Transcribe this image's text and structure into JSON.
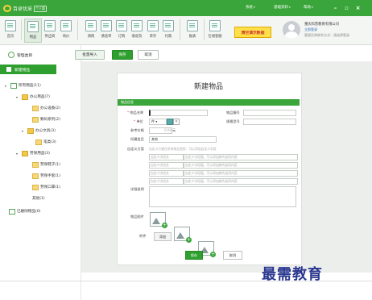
{
  "app": {
    "logo_text": "百卓优采",
    "edition": "个人版",
    "top_menu": [
      "系统",
      "基础资料",
      "帮助"
    ],
    "colors": {
      "primary": "#3aa53a",
      "primary_dark": "#2fa02f",
      "demo_button": "#ffe048",
      "watermark": "#2b3890"
    }
  },
  "toolbar": {
    "items": [
      {
        "label": "首页",
        "icon": "home-icon"
      },
      {
        "label": "物品",
        "icon": "goods-icon",
        "active": true
      },
      {
        "label": "供应商",
        "icon": "supplier-icon"
      },
      {
        "label": "询价",
        "icon": "inquiry-icon"
      },
      {
        "label": "请购",
        "icon": "request-icon"
      },
      {
        "label": "请验单",
        "icon": "inspection-icon"
      },
      {
        "label": "订购",
        "icon": "order-icon"
      },
      {
        "label": "收退货",
        "icon": "receive-icon"
      },
      {
        "label": "库存",
        "icon": "stock-icon"
      },
      {
        "label": "付款",
        "icon": "payment-icon"
      },
      {
        "label": "报表",
        "icon": "report-icon"
      },
      {
        "label": "在线客服",
        "icon": "service-icon"
      }
    ],
    "demo_button": "清空演示数据",
    "company": "重庆科普教育有限公司",
    "login": "立即登录",
    "contact": "管理员常联系方式：请选择登录"
  },
  "sidebar": {
    "manage_label": "管理类目",
    "new_goods": "新建物品",
    "tree": [
      {
        "label": "所有物品(11)",
        "level": 0
      },
      {
        "label": "办公用品(7)",
        "level": 1
      },
      {
        "label": "办公设备(2)",
        "level": 2
      },
      {
        "label": "数码系列(2)",
        "level": 2
      },
      {
        "label": "办公文具(3)",
        "level": 2
      },
      {
        "label": "笔类(3)",
        "level": 3
      },
      {
        "label": "劳保用品(3)",
        "level": 1
      },
      {
        "label": "劳保鞋子(1)",
        "level": 2
      },
      {
        "label": "劳保手套(1)",
        "level": 2
      },
      {
        "label": "劳保口罩(1)",
        "level": 2
      },
      {
        "label": "其他(1)",
        "level": 2
      },
      {
        "label": "已删除物品(0)",
        "level": 0
      }
    ]
  },
  "actions": {
    "import": "批量导入",
    "save": "保存",
    "cancel": "取消"
  },
  "form": {
    "title": "新建物品",
    "section": "物品信息",
    "fields": {
      "name_label": "物品名称",
      "code_label": "物品编号",
      "unit_label": "单位",
      "unit_value": "件",
      "spec_label": "规格型号",
      "ref_price_label": "参考价格",
      "ref_price_value": "0.00",
      "ref_price_unit": "元",
      "category_label": "所属类目",
      "category_value": "其他",
      "custom_label": "自定义方案",
      "custom_hint": "自定义方案在所有物品使用：可以添加自定义字段",
      "custom_rows": [
        [
          "自定义字段名",
          "自定义字段值，可以添加新的选项内容"
        ],
        [
          "自定义字段名",
          "自定义字段值，可以添加新的选项内容"
        ],
        [
          "自定义字段名",
          "自定义字段值，可以添加新的选项内容"
        ],
        [
          "自定义字段名",
          "自定义字段值，可以添加新的选项内容"
        ]
      ],
      "detail_label": "详细说明",
      "image_label": "物品图片",
      "attach_label": "附件",
      "attach_button": "添加"
    },
    "save_button": "保存",
    "cancel_button": "取消"
  },
  "watermark": "最需教育"
}
